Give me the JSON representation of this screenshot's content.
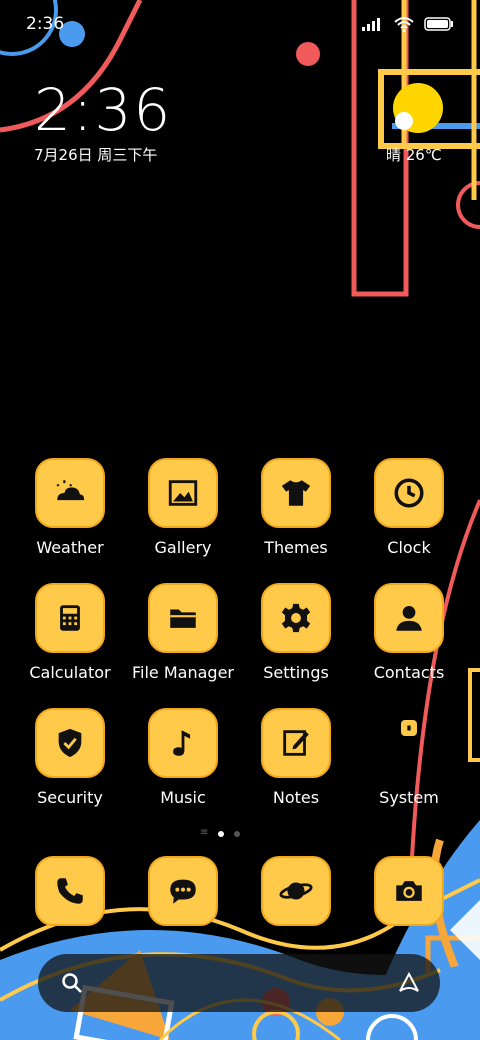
{
  "status_bar": {
    "time": "2:36"
  },
  "clock_widget": {
    "time": "2:36",
    "date": "7月26日 周三下午"
  },
  "weather_widget": {
    "text": "晴 26℃"
  },
  "apps": [
    {
      "label": "Weather",
      "icon": "weather-icon"
    },
    {
      "label": "Gallery",
      "icon": "gallery-icon"
    },
    {
      "label": "Themes",
      "icon": "themes-icon"
    },
    {
      "label": "Clock",
      "icon": "clock-icon"
    },
    {
      "label": "Calculator",
      "icon": "calculator-icon"
    },
    {
      "label": "File Manager",
      "icon": "folder-icon"
    },
    {
      "label": "Settings",
      "icon": "gear-icon"
    },
    {
      "label": "Contacts",
      "icon": "contact-icon"
    },
    {
      "label": "Security",
      "icon": "shield-icon"
    },
    {
      "label": "Music",
      "icon": "music-note-icon"
    },
    {
      "label": "Notes",
      "icon": "notes-icon"
    },
    {
      "label": "System",
      "icon": "folder-icon"
    }
  ],
  "dock": [
    {
      "icon": "phone-icon"
    },
    {
      "icon": "message-icon"
    },
    {
      "icon": "browser-icon"
    },
    {
      "icon": "camera-icon"
    }
  ],
  "page_indicator": {
    "pages": 2,
    "current": 1
  },
  "colors": {
    "tile": "#ffc94a",
    "tile_border": "#f2a81d",
    "red": "#f05a5a",
    "blue": "#4a9af0",
    "yellow": "#ffc94a"
  }
}
